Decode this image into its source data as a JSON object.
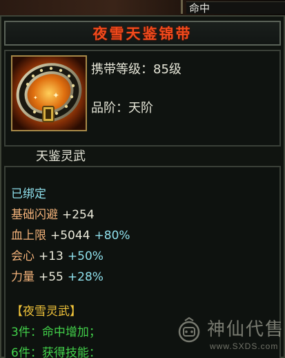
{
  "top_label": "命中",
  "title": "夜雪天鉴锦带",
  "item": {
    "icon": "belt-icon",
    "level_label": "携带等级：",
    "level_value": "85级",
    "grade_label": "品阶：",
    "grade_value": "天阶"
  },
  "set_name": "天鉴灵武",
  "bound": "已绑定",
  "attributes": [
    {
      "name": "基础闪避",
      "value": "+254",
      "extra": ""
    },
    {
      "name": "血上限",
      "value": "+5044",
      "extra": "+80%"
    },
    {
      "name": "会心",
      "value": "+13",
      "extra": "+50%"
    },
    {
      "name": "力量",
      "value": "+55",
      "extra": "+28%"
    }
  ],
  "set_bonus": {
    "title": "【夜雪灵武】",
    "tiers": [
      {
        "pieces": "3件：",
        "effect": "命中增加；"
      },
      {
        "pieces": "6件：",
        "effect": "获得技能："
      }
    ]
  },
  "watermark": {
    "text": "神仙代售",
    "url": "www.SXDS.com"
  },
  "colors": {
    "title": "#f24a1c",
    "attribute_name": "#f3b27a",
    "bonus_percent": "#8fe0ec",
    "set_title": "#f0c33a",
    "set_tier": "#42d14a",
    "bound": "#8fe0ec"
  }
}
